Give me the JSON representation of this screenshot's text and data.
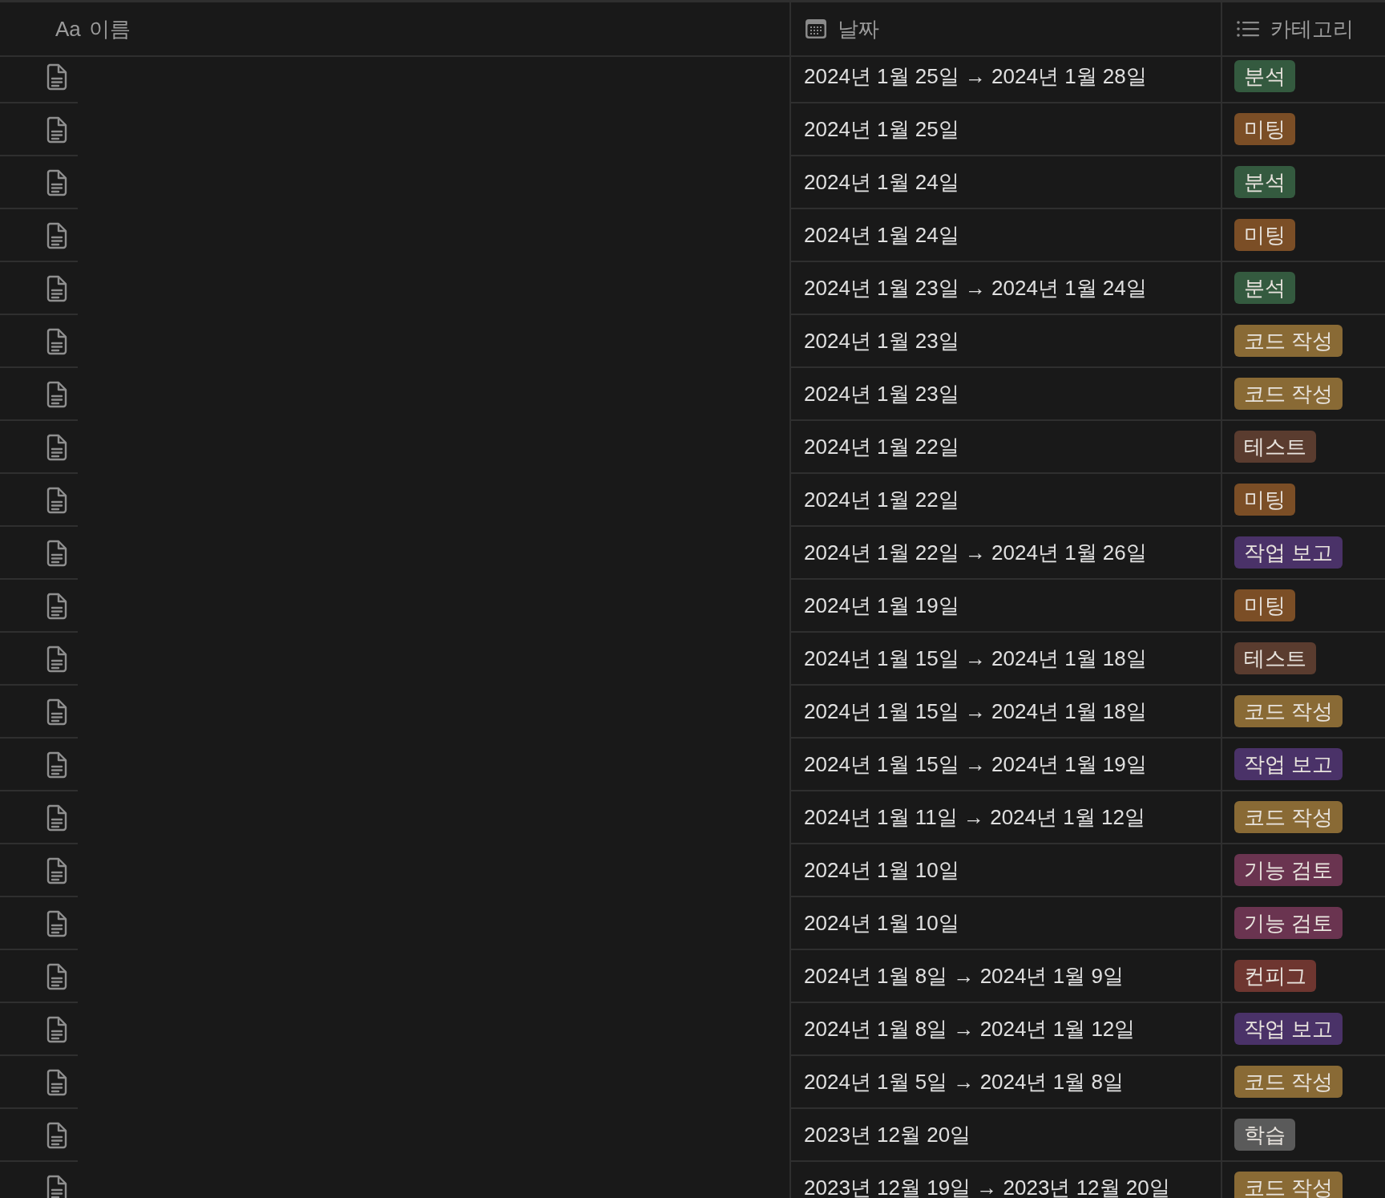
{
  "table": {
    "columns": [
      {
        "kind": "title",
        "label": "이름",
        "icon_text": "Aa"
      },
      {
        "kind": "date",
        "label": "날짜"
      },
      {
        "kind": "select",
        "label": "카테고리"
      }
    ],
    "rows": [
      {
        "date": "2024년 1월 25일 → 2024년 1월 28일",
        "category": {
          "label": "분석",
          "color": "#345a3f"
        }
      },
      {
        "date": "2024년 1월 25일",
        "category": {
          "label": "미팅",
          "color": "#7b4e26"
        }
      },
      {
        "date": "2024년 1월 24일",
        "category": {
          "label": "분석",
          "color": "#345a3f"
        }
      },
      {
        "date": "2024년 1월 24일",
        "category": {
          "label": "미팅",
          "color": "#7b4e26"
        }
      },
      {
        "date": "2024년 1월 23일 → 2024년 1월 24일",
        "category": {
          "label": "분석",
          "color": "#345a3f"
        }
      },
      {
        "date": "2024년 1월 23일",
        "category": {
          "label": "코드 작성",
          "color": "#896a35"
        }
      },
      {
        "date": "2024년 1월 23일",
        "category": {
          "label": "코드 작성",
          "color": "#896a35"
        }
      },
      {
        "date": "2024년 1월 22일",
        "category": {
          "label": "테스트",
          "color": "#5a3c2f"
        }
      },
      {
        "date": "2024년 1월 22일",
        "category": {
          "label": "미팅",
          "color": "#7b4e26"
        }
      },
      {
        "date": "2024년 1월 22일 → 2024년 1월 26일",
        "category": {
          "label": "작업 보고",
          "color": "#4a3268"
        }
      },
      {
        "date": "2024년 1월 19일",
        "category": {
          "label": "미팅",
          "color": "#7b4e26"
        }
      },
      {
        "date": "2024년 1월 15일 → 2024년 1월 18일",
        "category": {
          "label": "테스트",
          "color": "#5a3c2f"
        }
      },
      {
        "date": "2024년 1월 15일 → 2024년 1월 18일",
        "category": {
          "label": "코드 작성",
          "color": "#896a35"
        }
      },
      {
        "date": "2024년 1월 15일 → 2024년 1월 19일",
        "category": {
          "label": "작업 보고",
          "color": "#4a3268"
        }
      },
      {
        "date": "2024년 1월 11일 → 2024년 1월 12일",
        "category": {
          "label": "코드 작성",
          "color": "#896a35"
        }
      },
      {
        "date": "2024년 1월 10일",
        "category": {
          "label": "기능 검토",
          "color": "#6a3450"
        }
      },
      {
        "date": "2024년 1월 10일",
        "category": {
          "label": "기능 검토",
          "color": "#6a3450"
        }
      },
      {
        "date": "2024년 1월 8일 → 2024년 1월 9일",
        "category": {
          "label": "컨피그",
          "color": "#6e3630"
        }
      },
      {
        "date": "2024년 1월 8일 → 2024년 1월 12일",
        "category": {
          "label": "작업 보고",
          "color": "#4a3268"
        }
      },
      {
        "date": "2024년 1월 5일 → 2024년 1월 8일",
        "category": {
          "label": "코드 작성",
          "color": "#896a35"
        }
      },
      {
        "date": "2023년 12월 20일",
        "category": {
          "label": "학습",
          "color": "#5a5a5a"
        }
      },
      {
        "date": "2023년 12월 19일 → 2023년 12월 20일",
        "category": {
          "label": "코드 작성",
          "color": "#896a35"
        }
      }
    ]
  }
}
